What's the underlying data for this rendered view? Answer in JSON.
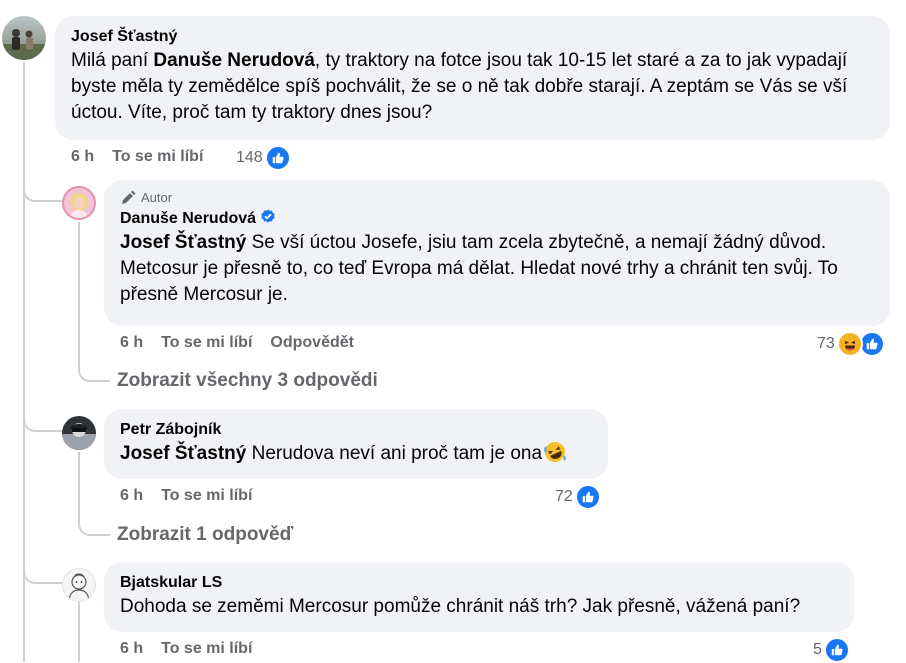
{
  "comments": [
    {
      "author": "Josef Šťastný",
      "text_before": "Milá paní ",
      "mention": "Danuše Nerudová",
      "text_after": ", ty traktory na fotce jsou tak 10-15 let staré a za to jak vypadají byste měla ty zemědělce spíš pochválit, že se o ně tak dobře starají. A zeptám se Vás se vší úctou. Víte, proč tam ty traktory dnes jsou?",
      "time": "6 h",
      "like_label": "To se mi líbí",
      "reaction_count": "148",
      "reactions": [
        "like"
      ]
    },
    {
      "badge": "Autor",
      "author": "Danuše Nerudová",
      "verified": true,
      "mention": "Josef Šťastný",
      "text_after": " Se vší úctou Josefe, jsiu tam zcela zbytečně, a nemají žádný důvod. Metcosur je přesně to, co teď Evropa má dělat. Hledat nové trhy a chránit ten svůj. To přesně Mercosur je.",
      "time": "6 h",
      "like_label": "To se mi líbí",
      "reply_label": "Odpovědět",
      "reaction_count": "73",
      "reactions": [
        "haha",
        "like"
      ],
      "view_replies": "Zobrazit všechny 3 odpovědi"
    },
    {
      "author": "Petr Zábojník",
      "mention": "Josef Šťastný",
      "text_after": " Nerudova neví ani proč tam je ona",
      "emoji": "rofl",
      "time": "6 h",
      "like_label": "To se mi líbí",
      "reaction_count": "72",
      "reactions": [
        "like"
      ],
      "view_replies": "Zobrazit 1 odpověď"
    },
    {
      "author": "Bjatskular LS",
      "text_after": "Dohoda se zeměmi Mercosur pomůže chránit náš trh? Jak přesně, vážená paní?",
      "time": "6 h",
      "like_label": "To se mi líbí",
      "reaction_count": "5",
      "reactions": [
        "like"
      ]
    }
  ],
  "colors": {
    "bubble": "#f0f2f5",
    "meta": "#65676b",
    "like_blue": "#1877f2",
    "thread_line": "#ced0d4"
  }
}
